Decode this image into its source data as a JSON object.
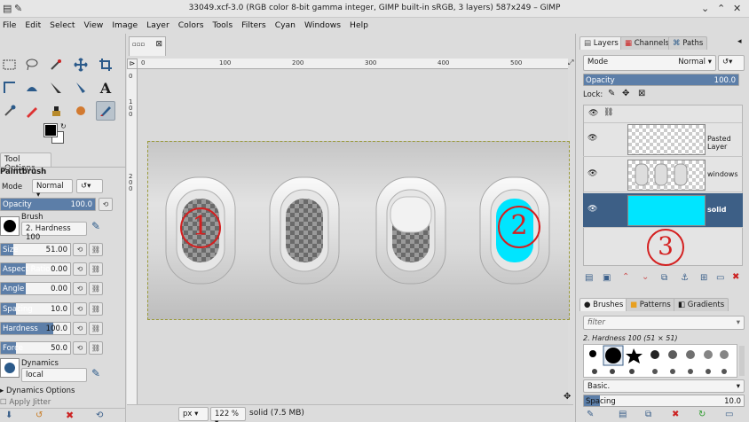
{
  "window": {
    "title": "33049.xcf-3.0 (RGB color 8-bit gamma integer, GIMP built-in sRGB, 3 layers) 587x249 – GIMP"
  },
  "menu": [
    "File",
    "Edit",
    "Select",
    "View",
    "Image",
    "Layer",
    "Colors",
    "Tools",
    "Filters",
    "Cyan",
    "Windows",
    "Help"
  ],
  "tool_options": {
    "tab_label": "Tool Options",
    "tool_name": "Paintbrush",
    "mode_label": "Mode",
    "mode_value": "Normal",
    "opacity": {
      "label": "Opacity",
      "value": "100.0",
      "fill": 1.0
    },
    "brush_label": "Brush",
    "brush_name": "2. Hardness 100",
    "size": {
      "label": "Size",
      "value": "51.00",
      "fill": 0.25
    },
    "aspect": {
      "label": "Aspect Ratio",
      "value": "0.00",
      "fill": 0.5
    },
    "angle": {
      "label": "Angle",
      "value": "0.00",
      "fill": 0.5
    },
    "spacing": {
      "label": "Spacing",
      "value": "10.0",
      "fill": 0.1
    },
    "hardness": {
      "label": "Hardness",
      "value": "100.0",
      "fill": 1.0
    },
    "force": {
      "label": "Force",
      "value": "50.0",
      "fill": 0.5
    },
    "dynamics_label": "Dynamics",
    "dynamics_value": "local",
    "dynamics_options": "Dynamics Options",
    "apply_jitter": "Apply Jitter"
  },
  "canvas": {
    "ruler_ticks": [
      "0",
      "100",
      "200",
      "300",
      "400",
      "500"
    ],
    "vruler_ticks": [
      "0",
      "1 0 0",
      "2 0 0"
    ],
    "unit": "px",
    "zoom": "122 %",
    "status": "solid (7.5 MB)",
    "annotations": [
      "1",
      "2"
    ]
  },
  "layers_panel": {
    "tabs": [
      "Layers",
      "Channels",
      "Paths"
    ],
    "mode_label": "Mode",
    "mode_value": "Normal",
    "opacity_label": "Opacity",
    "opacity_value": "100.0",
    "lock_label": "Lock:",
    "layers": [
      {
        "name": "Pasted Layer"
      },
      {
        "name": "windows"
      },
      {
        "name": "solid"
      }
    ],
    "annotation": "3"
  },
  "brushes_panel": {
    "tabs": [
      "Brushes",
      "Patterns",
      "Gradients"
    ],
    "filter_placeholder": "filter",
    "brush_info": "2. Hardness 100 (51 × 51)",
    "tag_value": "Basic.",
    "spacing_label": "Spacing",
    "spacing_value": "10.0"
  },
  "colors": {
    "accent": "#5c7ea8",
    "selection": "#3d5f86",
    "cyan": "#00e5ff",
    "annotation_red": "#d42020"
  }
}
